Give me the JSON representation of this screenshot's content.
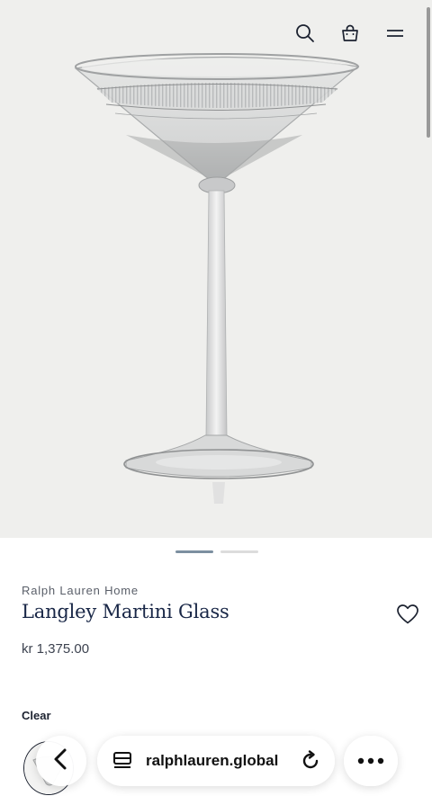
{
  "product": {
    "brand": "Ralph Lauren Home",
    "name": "Langley Martini Glass",
    "price": "kr 1,375.00",
    "image": "martini-glass-photo"
  },
  "header": {
    "icons": [
      "search-icon",
      "shopping-bag-icon",
      "menu-icon"
    ]
  },
  "carousel": {
    "slide_count": 2,
    "active_index": 0
  },
  "options": {
    "clear_label": "Clear"
  },
  "browser": {
    "url": "ralphlauren.global",
    "icons": [
      "back-icon",
      "tabs-icon",
      "reload-icon",
      "more-icon"
    ]
  },
  "colors": {
    "navy": "#182646",
    "hero_bg": "#efefed",
    "dot_active": "#7c8fa0"
  }
}
